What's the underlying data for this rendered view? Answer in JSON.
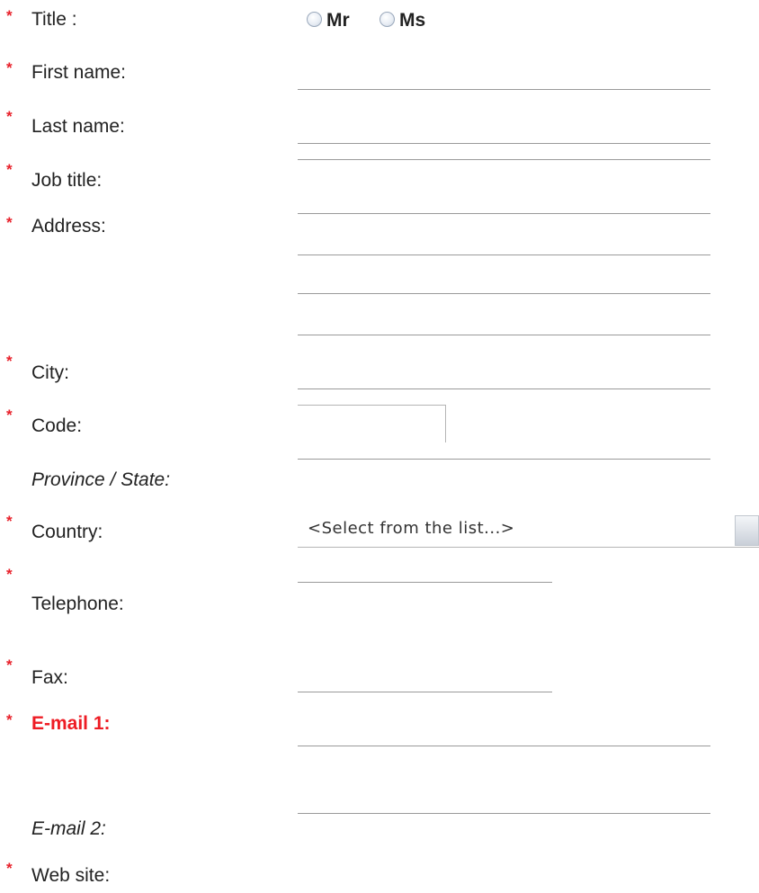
{
  "title": {
    "label": "Title :",
    "options": [
      "Mr",
      "Ms"
    ]
  },
  "first_name": {
    "label": "First name:"
  },
  "last_name": {
    "label": "Last name:"
  },
  "job_title": {
    "label": "Job title:"
  },
  "address": {
    "label": "Address:"
  },
  "city": {
    "label": "City:"
  },
  "code": {
    "label": "Code:"
  },
  "province": {
    "label": "Province / State:"
  },
  "country": {
    "label": "Country:",
    "selected": "<Select from the list...>"
  },
  "telephone": {
    "label": "Telephone:"
  },
  "fax": {
    "label": "Fax:"
  },
  "email1": {
    "label": "E-mail 1:"
  },
  "email2": {
    "label": "E-mail 2:"
  },
  "website": {
    "label": "Web site:"
  },
  "required_marker": "*",
  "colors": {
    "required": "#e8202a",
    "error_label": "#ee1c24",
    "field_line": "#9a9a9a"
  }
}
